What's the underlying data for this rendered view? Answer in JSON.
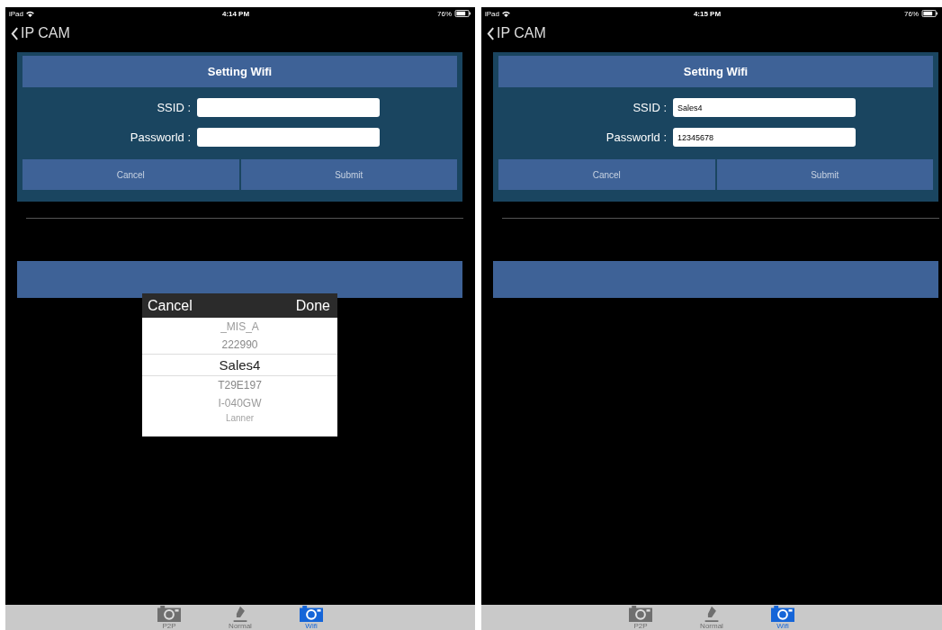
{
  "screens": [
    {
      "status_bar": {
        "device": "iPad",
        "time": "4:14 PM",
        "battery": "76%"
      },
      "nav": {
        "back_title": "IP CAM"
      },
      "dialog": {
        "title": "Setting Wifi",
        "fields": [
          {
            "label": "SSID :"
          },
          {
            "label": "Passworld :"
          }
        ],
        "buttons": [
          "Cancel",
          "Submit"
        ]
      },
      "picker": {
        "cancel": "Cancel",
        "done": "Done",
        "items": [
          {
            "label": "_MIS_A",
            "selected": false
          },
          {
            "label": "222990",
            "selected": false
          },
          {
            "label": "Sales4",
            "selected": true
          },
          {
            "label": "T29E197",
            "selected": false
          },
          {
            "label": "I-040GW",
            "selected": false
          },
          {
            "label": "Lanner",
            "selected": false
          }
        ]
      },
      "tabs": [
        {
          "label": "P2P",
          "kind": "camera",
          "selected": false
        },
        {
          "label": "Normal",
          "kind": "pen",
          "selected": false
        },
        {
          "label": "Wifi",
          "kind": "camera",
          "selected": true
        }
      ]
    },
    {
      "status_bar": {
        "device": "iPad",
        "time": "4:15 PM",
        "battery": "76%"
      },
      "nav": {
        "back_title": "IP CAM"
      },
      "dialog": {
        "title": "Setting Wifi",
        "fields": [
          {
            "label": "SSID :",
            "value": "Sales4"
          },
          {
            "label": "Passworld :",
            "value": "12345678"
          }
        ],
        "buttons": [
          "Cancel",
          "Submit"
        ]
      },
      "tabs": [
        {
          "label": "P2P",
          "kind": "camera",
          "selected": false
        },
        {
          "label": "Normal",
          "kind": "pen",
          "selected": false
        },
        {
          "label": "Wifi",
          "kind": "camera",
          "selected": true
        }
      ]
    }
  ]
}
